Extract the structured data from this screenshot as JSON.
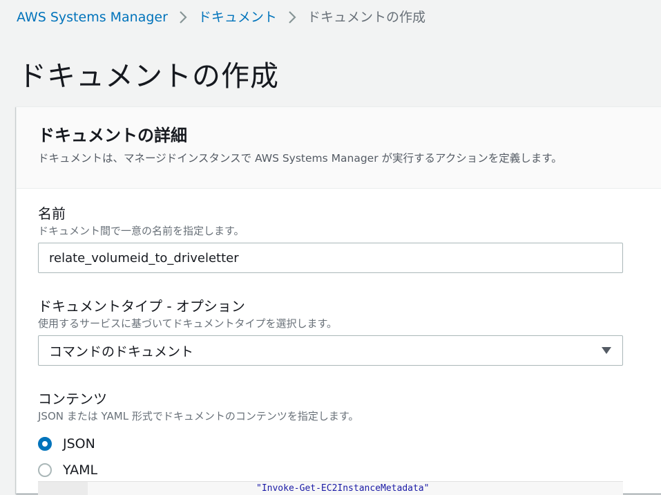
{
  "breadcrumb": {
    "items": [
      "AWS Systems Manager",
      "ドキュメント"
    ],
    "current": "ドキュメントの作成"
  },
  "page": {
    "title": "ドキュメントの作成"
  },
  "panel": {
    "title": "ドキュメントの詳細",
    "description": "ドキュメントは、マネージドインスタンスで AWS Systems Manager が実行するアクションを定義します。"
  },
  "fields": {
    "name": {
      "label": "名前",
      "description": "ドキュメント間で一意の名前を指定します。",
      "value": "relate_volumeid_to_driveletter"
    },
    "doc_type": {
      "label": "ドキュメントタイプ - オプション",
      "description": "使用するサービスに基づいてドキュメントタイプを選択します。",
      "selected": "コマンドのドキュメント"
    },
    "content": {
      "label": "コンテンツ",
      "description": "JSON または YAML 形式でドキュメントのコンテンツを指定します。",
      "options": [
        {
          "label": "JSON",
          "checked": true
        },
        {
          "label": "YAML",
          "checked": false
        }
      ]
    }
  },
  "editor": {
    "partial_line": "\"Invoke-Get-EC2InstanceMetadata\""
  },
  "colors": {
    "link": "#0073bb",
    "radio_selected": "#0073bb",
    "background": "#f2f3f3"
  },
  "icons": {
    "separator": "chevron-right-icon",
    "dropdown": "caret-down-icon"
  }
}
